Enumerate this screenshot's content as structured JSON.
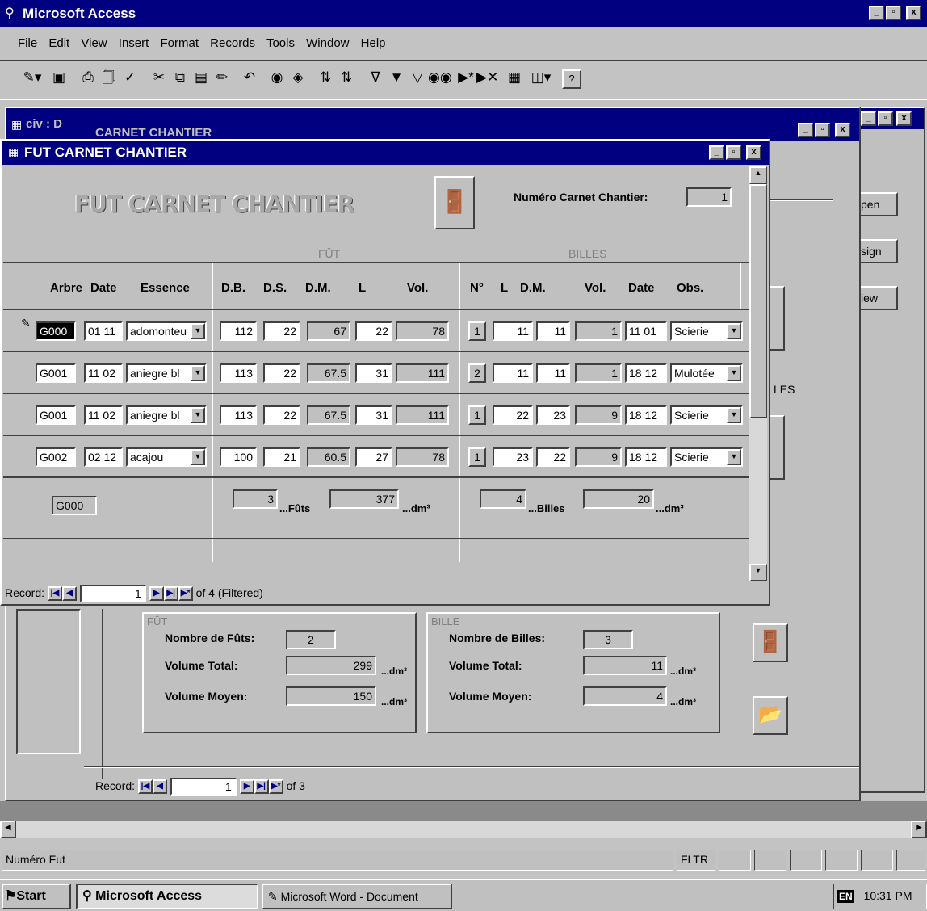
{
  "app": {
    "title": "Microsoft Access"
  },
  "menu": [
    "File",
    "Edit",
    "View",
    "Insert",
    "Format",
    "Records",
    "Tools",
    "Window",
    "Help"
  ],
  "back_window": {
    "title1": "civ : D",
    "title2": "CARNET CHANTIER"
  },
  "side_buttons": [
    "pen",
    "sign",
    "iew"
  ],
  "side_label": "LES",
  "fut_window": {
    "title": "FUT CARNET CHANTIER",
    "heading": "FUT CARNET CHANTIER",
    "numero_label": "Numéro Carnet Chantier:",
    "numero_value": "1",
    "group_fut": "FÛT",
    "group_billes": "BILLES",
    "columns": [
      "Arbre",
      "Date",
      "Essence",
      "D.B.",
      "D.S.",
      "D.M.",
      "L",
      "Vol.",
      "N°",
      "L",
      "D.M.",
      "Vol.",
      "Date",
      "Obs."
    ],
    "rows": [
      {
        "arbre": "G000",
        "date": "01 11",
        "essence": "adomonteu",
        "db": "112",
        "ds": "22",
        "dm": "67",
        "l": "22",
        "vol": "78",
        "n": "1",
        "bl": "11",
        "bdm": "11",
        "bvol": "1",
        "bdate": "11 01",
        "obs": "Scierie"
      },
      {
        "arbre": "G001",
        "date": "11 02",
        "essence": "aniegre bl",
        "db": "113",
        "ds": "22",
        "dm": "67.5",
        "l": "31",
        "vol": "111",
        "n": "2",
        "bl": "11",
        "bdm": "11",
        "bvol": "1",
        "bdate": "18 12",
        "obs": "Mulotée"
      },
      {
        "arbre": "G001",
        "date": "11 02",
        "essence": "aniegre bl",
        "db": "113",
        "ds": "22",
        "dm": "67.5",
        "l": "31",
        "vol": "111",
        "n": "1",
        "bl": "22",
        "bdm": "23",
        "bvol": "9",
        "bdate": "18 12",
        "obs": "Scierie"
      },
      {
        "arbre": "G002",
        "date": "02 12",
        "essence": "acajou",
        "db": "100",
        "ds": "21",
        "dm": "60.5",
        "l": "27",
        "vol": "78",
        "n": "1",
        "bl": "23",
        "bdm": "22",
        "bvol": "9",
        "bdate": "18 12",
        "obs": "Scierie"
      }
    ],
    "footer": {
      "arbre": "G000",
      "futs_count": "3",
      "futs_label": "...Fûts",
      "futs_vol": "377",
      "futs_unit": "...dm³",
      "billes_count": "4",
      "billes_label": "...Billes",
      "billes_vol": "20",
      "billes_unit": "...dm³"
    },
    "record_label": "Record:",
    "record_value": "1",
    "record_of": "of 4 (Filtered)"
  },
  "summary": {
    "fut_group": "FÛT",
    "bille_group": "BILLE",
    "nb_futs_label": "Nombre de Fûts:",
    "nb_futs": "2",
    "vol_total_label": "Volume Total:",
    "fut_vol_total": "299",
    "vol_moyen_label": "Volume Moyen:",
    "fut_vol_moyen": "150",
    "unit": "...dm³",
    "nb_billes_label": "Nombre de Billes:",
    "nb_billes": "3",
    "bille_vol_total": "11",
    "bille_vol_moyen": "4",
    "record_label": "Record:",
    "record_value": "1",
    "record_of": "of 3"
  },
  "status": {
    "text": "Numéro Fut",
    "fltr": "FLTR"
  },
  "taskbar": {
    "start": "Start",
    "task1": "Microsoft Access",
    "task2": "Microsoft Word - Document",
    "lang": "EN",
    "clock": "10:31 PM"
  }
}
